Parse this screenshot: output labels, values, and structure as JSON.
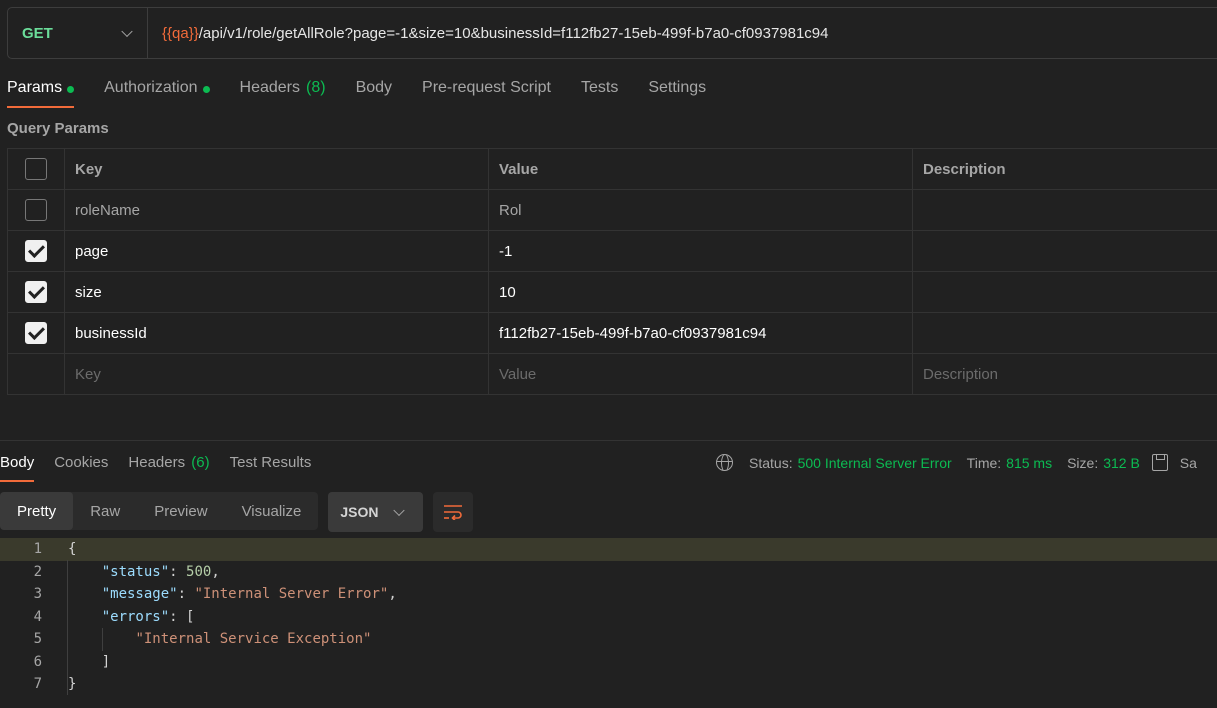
{
  "request": {
    "method": "GET",
    "url_variable": "{{qa}}",
    "url_path": "/api/v1/role/getAllRole?page=-1&size=10&businessId=f112fb27-15eb-499f-b7a0-cf0937981c94"
  },
  "request_tabs": [
    {
      "label": "Params",
      "dot": true,
      "active": true
    },
    {
      "label": "Authorization",
      "dot": true
    },
    {
      "label": "Headers",
      "count": "(8)"
    },
    {
      "label": "Body"
    },
    {
      "label": "Pre-request Script"
    },
    {
      "label": "Tests"
    },
    {
      "label": "Settings"
    }
  ],
  "query_params": {
    "title": "Query Params",
    "headers": {
      "key": "Key",
      "value": "Value",
      "description": "Description"
    },
    "rows": [
      {
        "key": "roleName",
        "value": "Rol",
        "enabled": false
      },
      {
        "key": "page",
        "value": "-1",
        "enabled": true
      },
      {
        "key": "size",
        "value": "10",
        "enabled": true
      },
      {
        "key": "businessId",
        "value": "f112fb27-15eb-499f-b7a0-cf0937981c94",
        "enabled": true
      }
    ],
    "placeholders": {
      "key": "Key",
      "value": "Value",
      "description": "Description"
    }
  },
  "response_tabs": [
    {
      "label": "Body",
      "active": true
    },
    {
      "label": "Cookies"
    },
    {
      "label": "Headers",
      "count": "(6)"
    },
    {
      "label": "Test Results"
    }
  ],
  "status_bar": {
    "status_label": "Status:",
    "status_value": "500 Internal Server Error",
    "time_label": "Time:",
    "time_value": "815 ms",
    "size_label": "Size:",
    "size_value": "312 B",
    "save_label": "Sa"
  },
  "view_modes": [
    "Pretty",
    "Raw",
    "Preview",
    "Visualize"
  ],
  "format": "JSON",
  "code": {
    "line_numbers": [
      "1",
      "2",
      "3",
      "4",
      "5",
      "6",
      "7"
    ],
    "open_brace": "{",
    "close_brace": "}",
    "k_status": "\"status\"",
    "v_status": "500",
    "k_message": "\"message\"",
    "v_message": "\"Internal Server Error\"",
    "k_errors": "\"errors\"",
    "v_error_item": "\"Internal Service Exception\"",
    "colon": ": ",
    "comma": ",",
    "open_bracket": "[",
    "close_bracket": "]"
  },
  "colors": {
    "accent": "#f26b3a",
    "success": "#0cbb52",
    "method": "#6bdd9a"
  }
}
